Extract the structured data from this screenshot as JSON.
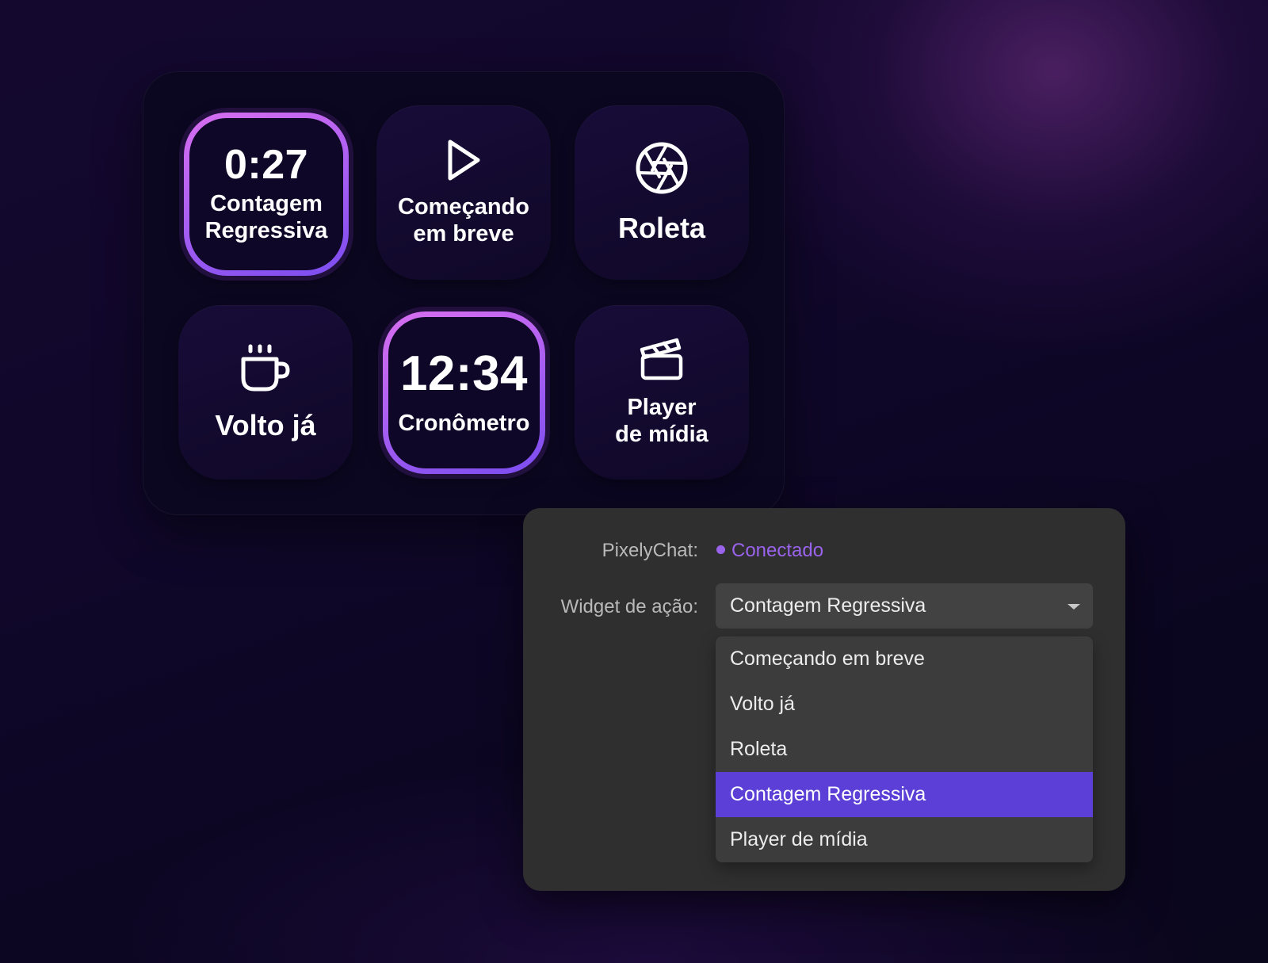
{
  "deck": {
    "keys": [
      {
        "type": "timer",
        "value": "0:27",
        "label_line1": "Contagem",
        "label_line2": "Regressiva",
        "active": true
      },
      {
        "type": "icon",
        "icon": "play-icon",
        "label_line1": "Começando",
        "label_line2": "em breve",
        "active": false
      },
      {
        "type": "icon",
        "icon": "aperture-icon",
        "label_line1": "Roleta",
        "active": false
      },
      {
        "type": "icon",
        "icon": "coffee-cup-icon",
        "label_line1": "Volto já",
        "active": false
      },
      {
        "type": "timer",
        "value": "12:34",
        "label_line1": "Cronômetro",
        "active": true
      },
      {
        "type": "icon",
        "icon": "clapperboard-icon",
        "label_line1": "Player",
        "label_line2": "de mídia",
        "active": false
      }
    ]
  },
  "settings": {
    "chat_label": "PixelyChat:",
    "chat_status": "Conectado",
    "status_color": "#9a63ec",
    "widget_label": "Widget de ação:",
    "widget_selected": "Contagem Regressiva",
    "options": [
      "Começando em breve",
      "Volto já",
      "Roleta",
      "Contagem Regressiva",
      "Player de mídia"
    ],
    "selected_index": 3,
    "highlight_color": "#5b3fd6"
  },
  "colors": {
    "accent_gradient_start": "#d86ef0",
    "accent_gradient_end": "#7b4cef",
    "panel_bg": "#2f2f2f"
  }
}
